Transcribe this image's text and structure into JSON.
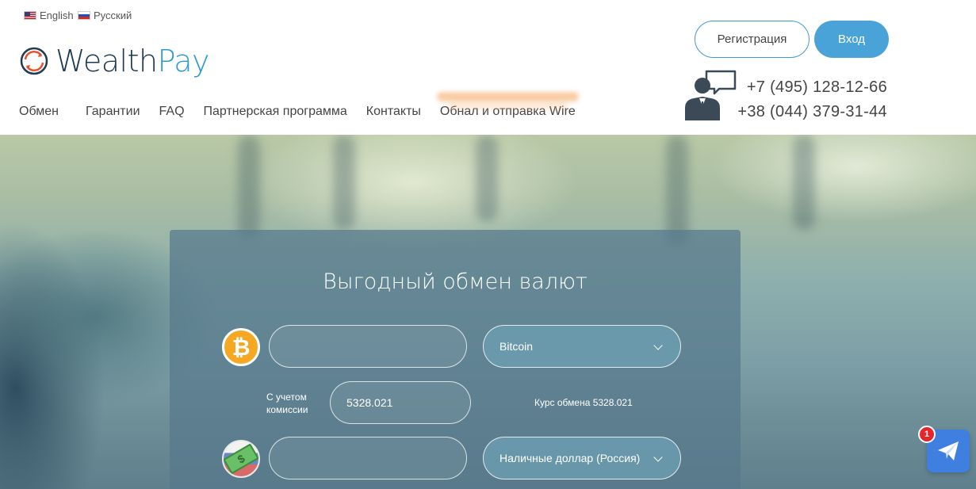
{
  "languages": [
    {
      "label": "English"
    },
    {
      "label": "Русский"
    }
  ],
  "logo": {
    "part1": "Wealth",
    "part2": "Pay"
  },
  "nav": [
    {
      "label": "Обмен"
    },
    {
      "label": "Гарантии"
    },
    {
      "label": "FAQ"
    },
    {
      "label": "Партнерская программа"
    },
    {
      "label": "Контакты"
    },
    {
      "label": "Обнал и отправка Wire"
    }
  ],
  "auth": {
    "register_label": "Регистрация",
    "login_label": "Вход"
  },
  "contacts": {
    "phone1": "+7 (495) 128-12-66",
    "phone2": "+38 (044) 379-31-44"
  },
  "exchange": {
    "title": "Выгодный обмен валют",
    "give": {
      "amount": "",
      "currency": "Bitcoin",
      "icon": "bitcoin-icon"
    },
    "commission_label": "С учетом комиссии",
    "commission_value": "5328.021",
    "rate_text": "Курс обмена 5328.021",
    "get": {
      "amount": "",
      "currency": "Наличные доллар (Россия)",
      "icon": "cash-usd-icon"
    }
  },
  "chat": {
    "badge_count": "1"
  },
  "colors": {
    "accent": "#4aa3d8",
    "brand_dark": "#1f3b52",
    "bitcoin": "#f7a823",
    "chat": "#3f7fe0",
    "badge": "#e5252a"
  }
}
